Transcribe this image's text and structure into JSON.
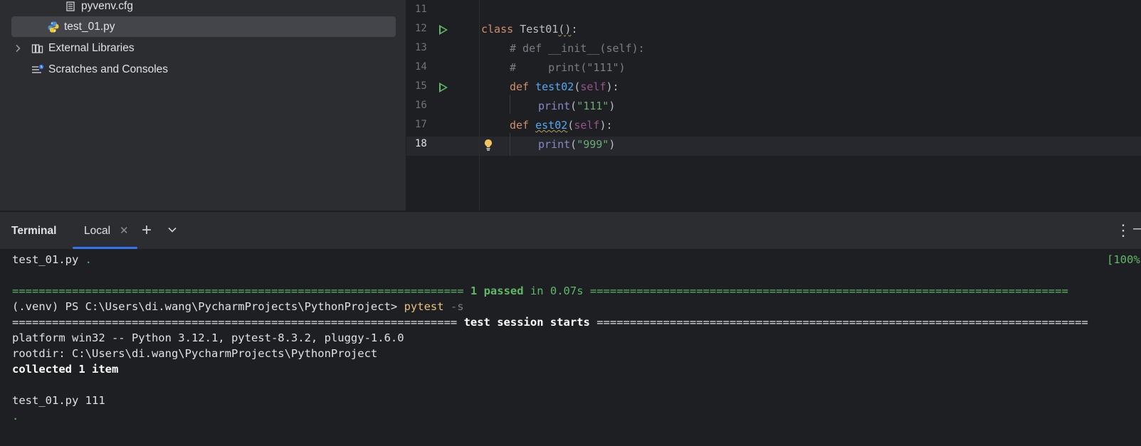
{
  "project_tree": {
    "items": [
      {
        "label": "pyvenv.cfg",
        "icon": "config-file-icon"
      },
      {
        "label": "test_01.py",
        "icon": "python-file-icon",
        "selected": true
      },
      {
        "label": "External Libraries",
        "icon": "library-icon"
      },
      {
        "label": "Scratches and Consoles",
        "icon": "scratches-icon"
      }
    ]
  },
  "editor": {
    "line_numbers": [
      "11",
      "12",
      "13",
      "14",
      "15",
      "16",
      "17",
      "18"
    ],
    "lines": {
      "l12_kw": "class",
      "l12_name": "Test01",
      "l12_paren": "()",
      "l12_colon": ":",
      "l13": "# def __init__(self):",
      "l14": "#     print(\"111\")",
      "l15_kw": "def",
      "l15_fn": "test02",
      "l15_open": "(",
      "l15_self": "self",
      "l15_close": "):",
      "l16_fn": "print",
      "l16_open": "(",
      "l16_str": "\"111\"",
      "l16_close": ")",
      "l17_kw": "def",
      "l17_fn": "est02",
      "l17_open": "(",
      "l17_self": "self",
      "l17_close": "):",
      "l18_fn": "print",
      "l18_open": "(",
      "l18_str": "\"999\"",
      "l18_close": ")"
    }
  },
  "terminal": {
    "title": "Terminal",
    "tab_label": "Local",
    "add_tab": "+",
    "output": {
      "line1_file": "test_01.py",
      "line1_dot": ".",
      "line1_pct": "[100%",
      "line2_left": "==================================================================== ",
      "line2_passed": "1 passed",
      "line2_time": " in 0.07s ",
      "line2_right": "========================================================================",
      "line3_prompt": "(.venv) PS C:\\Users\\di.wang\\PycharmProjects\\PythonProject> ",
      "line3_cmd": "pytest",
      "line3_arg": " -s",
      "line4_left": "=================================================================== ",
      "line4_mid": "test session starts",
      "line4_right": " ==========================================================================",
      "line5": "platform win32 -- Python 3.12.1, pytest-8.3.2, pluggy-1.6.0",
      "line6": "rootdir: C:\\Users\\di.wang\\PycharmProjects\\PythonProject",
      "line7": "collected 1 item",
      "line8": "test_01.py 111",
      "line9": "."
    }
  },
  "colors": {
    "accent": "#3574f0",
    "run_icon": "#5fb865",
    "keyword": "#cf8e6d",
    "function": "#56a8f5",
    "string": "#6aab73"
  }
}
